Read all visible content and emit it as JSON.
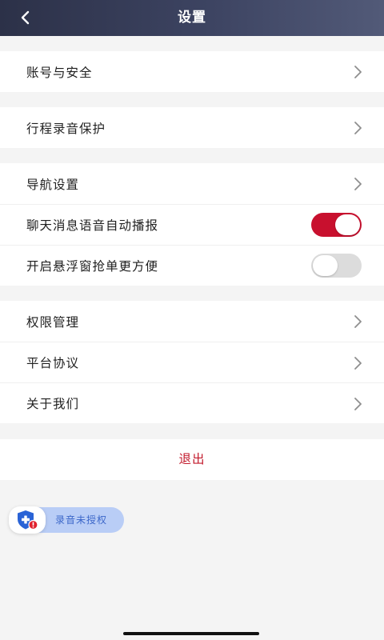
{
  "header": {
    "title": "设置",
    "back_icon": "chevron-left-icon"
  },
  "groups": [
    {
      "items": [
        {
          "label": "账号与安全",
          "type": "link"
        }
      ]
    },
    {
      "items": [
        {
          "label": "行程录音保护",
          "type": "link"
        }
      ]
    },
    {
      "items": [
        {
          "label": "导航设置",
          "type": "link"
        },
        {
          "label": "聊天消息语音自动播报",
          "type": "toggle",
          "on": true
        },
        {
          "label": "开启悬浮窗抢单更方便",
          "type": "toggle",
          "on": false
        }
      ]
    },
    {
      "items": [
        {
          "label": "权限管理",
          "type": "link"
        },
        {
          "label": "平台协议",
          "type": "link"
        },
        {
          "label": "关于我们",
          "type": "link"
        }
      ]
    }
  ],
  "logout_label": "退出",
  "recording_badge": {
    "label": "录音未授权",
    "icon": "shield-alert-icon"
  },
  "colors": {
    "accent": "#c8102e",
    "header_start": "#2c3148",
    "header_end": "#525a78",
    "badge_bg": "#b9cdf6"
  }
}
